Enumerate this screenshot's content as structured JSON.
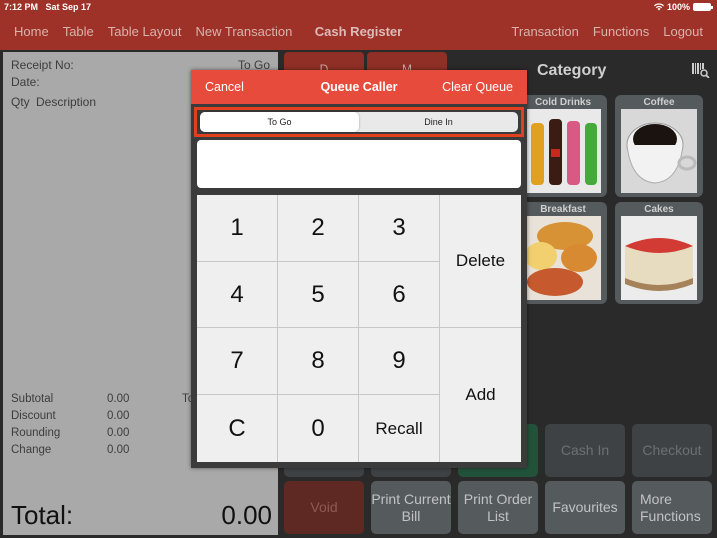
{
  "status_bar": {
    "time": "7:12 PM",
    "date": "Sat Sep 17",
    "wifi_icon": "wifi-icon",
    "battery": "100%"
  },
  "nav": {
    "left_items": [
      "Home",
      "Table",
      "Table Layout",
      "New Transaction"
    ],
    "title": "Cash Register",
    "right_items": [
      "Transaction",
      "Functions",
      "Logout"
    ]
  },
  "receipt": {
    "receipt_no_label": "Receipt No:",
    "order_type": "To Go",
    "date_label": "Date:",
    "qty_header": "Qty",
    "desc_header": "Description",
    "summary": [
      {
        "label": "Subtotal",
        "value": "0.00"
      },
      {
        "label": "Discount",
        "value": "0.00"
      },
      {
        "label": "Rounding",
        "value": "0.00"
      },
      {
        "label": "Change",
        "value": "0.00"
      }
    ],
    "partial_label": "To",
    "total_label": "Total:",
    "total_value": "0.00"
  },
  "category_tabs": [
    "D",
    "M"
  ],
  "category": {
    "title": "Category",
    "barcode_icon": "barcode-search-icon",
    "items": [
      {
        "label": "Cold Drinks"
      },
      {
        "label": "Coffee"
      },
      {
        "label": "Breakfast"
      },
      {
        "label": "Cakes"
      }
    ]
  },
  "function_buttons": {
    "row1": [
      "",
      "",
      "",
      "Cash In",
      "Checkout"
    ],
    "row2": [
      "Void",
      "Print Current Bill",
      "Print Order List",
      "Favourites",
      "More Functions"
    ]
  },
  "queue_caller": {
    "cancel_label": "Cancel",
    "title": "Queue Caller",
    "clear_label": "Clear Queue",
    "segments": [
      "To Go",
      "Dine In"
    ],
    "selected_segment": "To Go",
    "display_value": "",
    "keys": [
      "1",
      "2",
      "3",
      "4",
      "5",
      "6",
      "7",
      "8",
      "9",
      "C",
      "0",
      "Recall"
    ],
    "delete_label": "Delete",
    "add_label": "Add"
  }
}
